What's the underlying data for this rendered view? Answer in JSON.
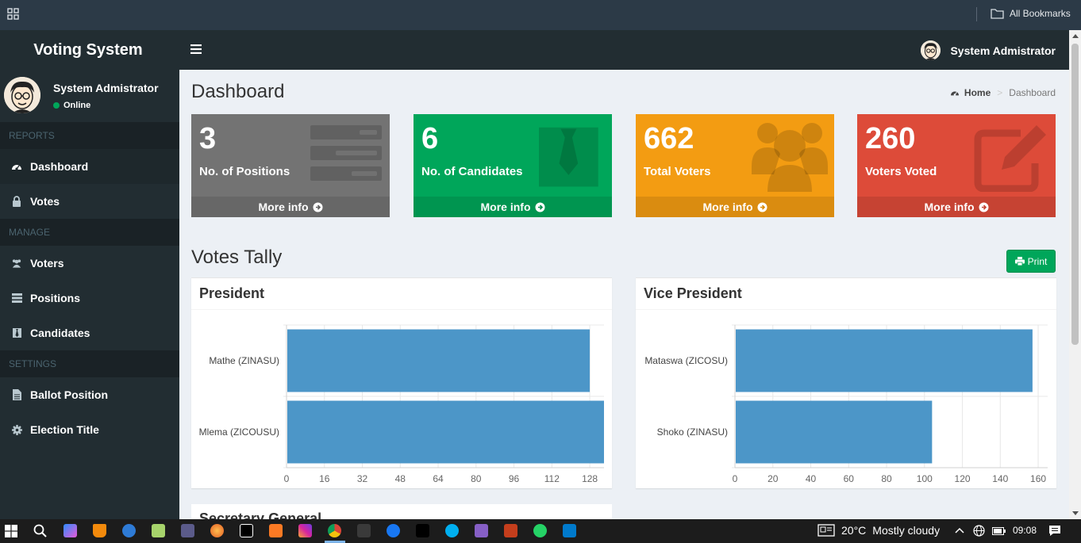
{
  "browser": {
    "all_bookmarks": "All Bookmarks"
  },
  "sidebar": {
    "brand": "Voting System",
    "user": {
      "name": "System Admistrator",
      "status": "Online"
    },
    "sections": [
      {
        "header": "REPORTS",
        "items": [
          {
            "label": "Dashboard",
            "icon": "dashboard-icon"
          },
          {
            "label": "Votes",
            "icon": "lock-icon"
          }
        ]
      },
      {
        "header": "MANAGE",
        "items": [
          {
            "label": "Voters",
            "icon": "users-icon"
          },
          {
            "label": "Positions",
            "icon": "tasks-icon"
          },
          {
            "label": "Candidates",
            "icon": "black-tie-icon"
          }
        ]
      },
      {
        "header": "SETTINGS",
        "items": [
          {
            "label": "Ballot Position",
            "icon": "file-text-icon"
          },
          {
            "label": "Election Title",
            "icon": "cog-icon"
          }
        ]
      }
    ]
  },
  "navbar": {
    "user_name": "System Admistrator"
  },
  "content": {
    "title": "Dashboard",
    "breadcrumb": {
      "home": "Home",
      "separator": ">",
      "current": "Dashboard"
    },
    "boxes": [
      {
        "number": "3",
        "label": "No. of Positions",
        "more": "More info",
        "color": "#737373",
        "icon": "tasks-icon"
      },
      {
        "number": "6",
        "label": "No. of Candidates",
        "more": "More info",
        "color": "#00a65a",
        "icon": "black-tie-icon"
      },
      {
        "number": "662",
        "label": "Total Voters",
        "more": "More info",
        "color": "#f39c12",
        "icon": "users-icon"
      },
      {
        "number": "260",
        "label": "Voters Voted",
        "more": "More info",
        "color": "#dd4b39",
        "icon": "edit-icon"
      }
    ],
    "tally_title": "Votes Tally",
    "print_label": "Print",
    "partial_title": "Secretary General"
  },
  "chart_data": [
    {
      "type": "bar",
      "orientation": "horizontal",
      "title": "President",
      "categories": [
        "Mathe (ZINASU)",
        "Mlema (ZICOUSU)"
      ],
      "values": [
        128,
        134
      ],
      "xlim": [
        0,
        134
      ],
      "xticks": [
        0,
        16,
        32,
        48,
        64,
        80,
        96,
        112,
        128
      ],
      "grid": true,
      "color": "#4c96c8"
    },
    {
      "type": "bar",
      "orientation": "horizontal",
      "title": "Vice President",
      "categories": [
        "Mataswa (ZICOSU)",
        "Shoko (ZINASU)"
      ],
      "values": [
        157,
        104
      ],
      "xlim": [
        0,
        165
      ],
      "xticks": [
        0,
        20,
        40,
        60,
        80,
        100,
        120,
        140,
        160
      ],
      "grid": true,
      "color": "#4c96c8"
    }
  ],
  "taskbar": {
    "temperature": "20°C",
    "weather": "Mostly cloudy",
    "time": "09:08"
  }
}
